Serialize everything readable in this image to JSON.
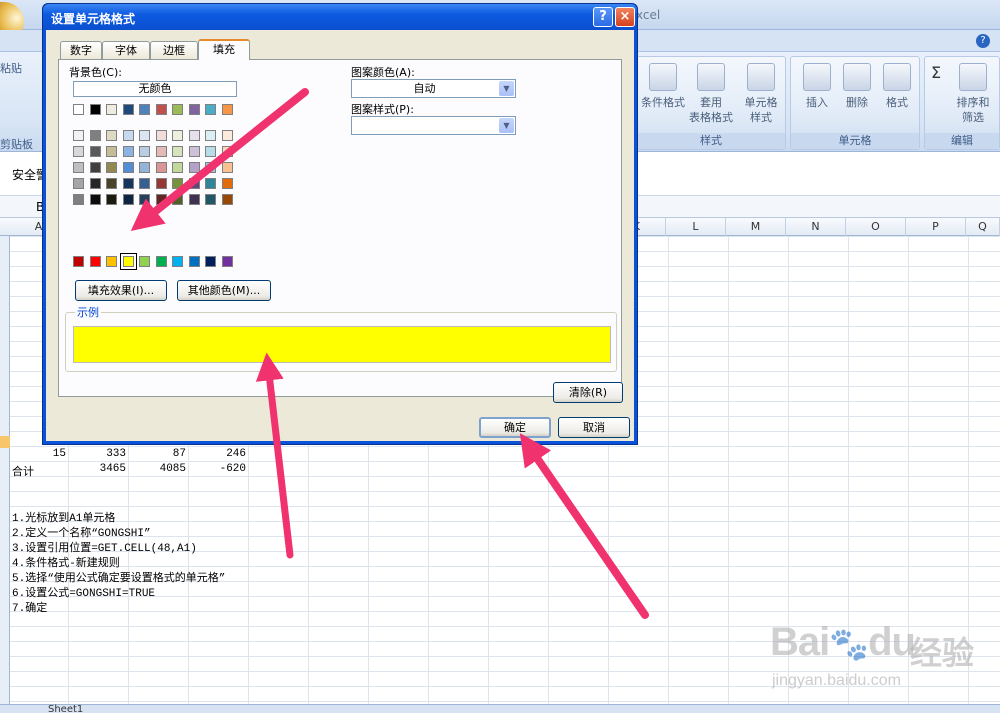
{
  "window": {
    "title_fragment": "xcel"
  },
  "ribbon": {
    "clipboard_group": "剪贴板",
    "paste_label": "粘贴",
    "styles_group": "样式",
    "cells_group": "单元格",
    "editing_group": "编辑",
    "buttons": [
      {
        "name": "conditional-format-button",
        "label1": "条件格式",
        "label2": ""
      },
      {
        "name": "table-format-button",
        "label1": "套用",
        "label2": "表格格式"
      },
      {
        "name": "cell-style-button",
        "label1": "单元格",
        "label2": "样式"
      },
      {
        "name": "insert-button",
        "label1": "插入",
        "label2": ""
      },
      {
        "name": "delete-button",
        "label1": "删除",
        "label2": ""
      },
      {
        "name": "format-button",
        "label1": "格式",
        "label2": ""
      },
      {
        "name": "sort-filter-button",
        "label1": "排序和",
        "label2": "筛选"
      }
    ],
    "sigma": "Σ"
  },
  "security_bar": {
    "label": "安全警"
  },
  "formula_bar": {
    "name_box_fragment": "B"
  },
  "columns": [
    "A",
    "K",
    "L",
    "M",
    "N",
    "O",
    "P",
    "Q"
  ],
  "sheet": {
    "row15": {
      "a": "15",
      "b": "333",
      "c": "87",
      "d": "246"
    },
    "total": {
      "label": "合计",
      "b": "3465",
      "c": "4085",
      "d": "-620"
    },
    "notes": [
      "1.光标放到A1单元格",
      "2.定义一个名称“GONGSHI”",
      "3.设置引用位置=GET.CELL(48,A1)",
      "4.条件格式-新建规则",
      "5.选择“使用公式确定要设置格式的单元格”",
      "6.设置公式=GONGSHI=TRUE",
      "7.确定"
    ],
    "tab": "Sheet1"
  },
  "dialog": {
    "title": "设置单元格格式",
    "help": "?",
    "close": "×",
    "tabs": [
      "数字",
      "字体",
      "边框",
      "填充"
    ],
    "active_tab": "填充",
    "bg_color_label": "背景色(C):",
    "no_color": "无颜色",
    "palette": [
      [
        "#ffffff",
        "#000000",
        "#eeece1",
        "#1f497d",
        "#4f81bd",
        "#c0504d",
        "#9bbb59",
        "#8064a2",
        "#4bacc6",
        "#f79646"
      ],
      [
        "#f2f2f2",
        "#7f7f7f",
        "#ddd9c3",
        "#c6d9f0",
        "#dbe5f1",
        "#f2dcdb",
        "#ebf1dd",
        "#e5e0ec",
        "#dbeef3",
        "#fdeada"
      ],
      [
        "#d8d8d8",
        "#595959",
        "#c4bd97",
        "#8db3e2",
        "#b8cce4",
        "#e5b9b7",
        "#d7e3bc",
        "#ccc1d9",
        "#b7dde8",
        "#fbd5b5"
      ],
      [
        "#bfbfbf",
        "#3f3f3f",
        "#938953",
        "#548dd4",
        "#95b3d7",
        "#d99694",
        "#c3d69b",
        "#b2a2c7",
        "#92cddc",
        "#fac08f"
      ],
      [
        "#a5a5a5",
        "#262626",
        "#494429",
        "#17365d",
        "#366092",
        "#953734",
        "#76923c",
        "#5f497a",
        "#31859b",
        "#e36c09"
      ],
      [
        "#7f7f7f",
        "#0c0c0c",
        "#1d1b10",
        "#0f243e",
        "#244061",
        "#632423",
        "#4f6128",
        "#3f3151",
        "#205867",
        "#974806"
      ]
    ],
    "standard_colors": [
      "#c00000",
      "#ff0000",
      "#ffc000",
      "#ffff00",
      "#92d050",
      "#00b050",
      "#00b0f0",
      "#0070c0",
      "#002060",
      "#7030a0"
    ],
    "selected_color": "#ffff00",
    "fill_effect_button": "填充效果(I)...",
    "more_colors_button": "其他颜色(M)...",
    "pattern_color_label": "图案颜色(A):",
    "pattern_color_value": "自动",
    "pattern_style_label": "图案样式(P):",
    "pattern_style_value": "",
    "sample_label": "示例",
    "sample_color": "#ffff00",
    "clear_button": "清除(R)",
    "ok_button": "确定",
    "cancel_button": "取消"
  },
  "annotation": {
    "arrow_color": "#f0326e"
  },
  "watermark": {
    "logo": "Bai",
    "logo_suffix": "du",
    "cn": "经验",
    "url": "jingyan.baidu.com"
  }
}
